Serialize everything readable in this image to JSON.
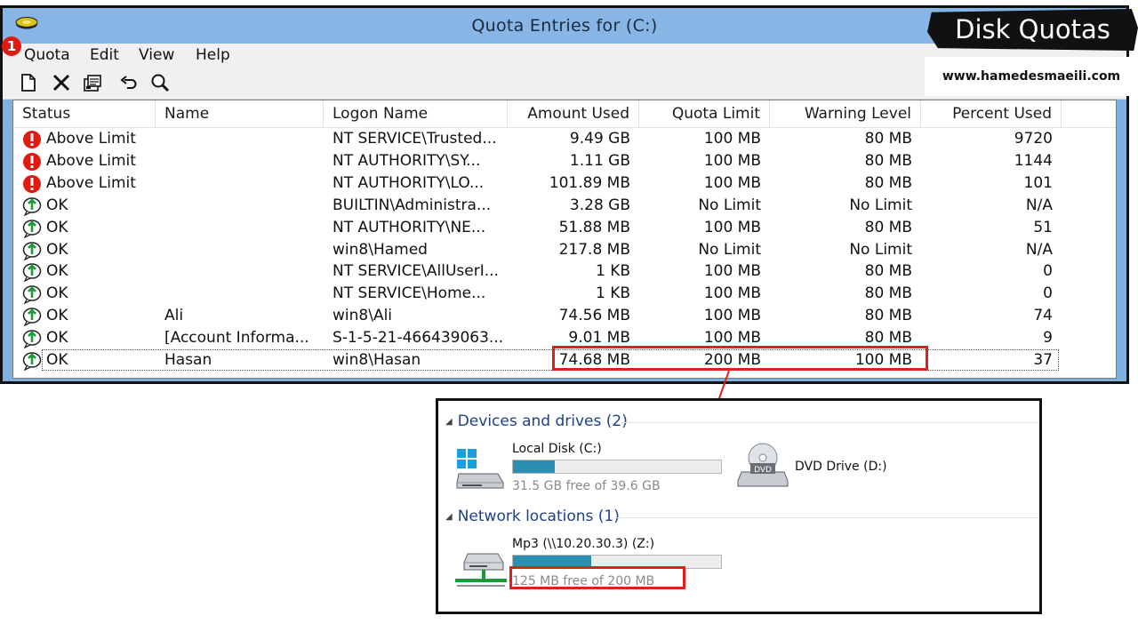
{
  "window": {
    "title": "Quota Entries for  (C:)",
    "badge": "1",
    "menu": [
      "Quota",
      "Edit",
      "View",
      "Help"
    ]
  },
  "toolbar": {
    "icons": [
      "new-entry-icon",
      "delete-icon",
      "properties-icon",
      "undo-icon",
      "find-icon"
    ]
  },
  "table": {
    "columns": [
      "Status",
      "Name",
      "Logon Name",
      "Amount Used",
      "Quota Limit",
      "Warning Level",
      "Percent Used"
    ],
    "rows": [
      {
        "status": "Above Limit",
        "name": "",
        "logon": "NT SERVICE\\Trusted...",
        "used": "9.49 GB",
        "limit": "100 MB",
        "warning": "80 MB",
        "percent": "9720"
      },
      {
        "status": "Above Limit",
        "name": "",
        "logon": "NT AUTHORITY\\SY...",
        "used": "1.11 GB",
        "limit": "100 MB",
        "warning": "80 MB",
        "percent": "1144"
      },
      {
        "status": "Above Limit",
        "name": "",
        "logon": "NT AUTHORITY\\LO...",
        "used": "101.89 MB",
        "limit": "100 MB",
        "warning": "80 MB",
        "percent": "101"
      },
      {
        "status": "OK",
        "name": "",
        "logon": "BUILTIN\\Administra...",
        "used": "3.28 GB",
        "limit": "No Limit",
        "warning": "No Limit",
        "percent": "N/A"
      },
      {
        "status": "OK",
        "name": "",
        "logon": "NT AUTHORITY\\NE...",
        "used": "51.88 MB",
        "limit": "100 MB",
        "warning": "80 MB",
        "percent": "51"
      },
      {
        "status": "OK",
        "name": "",
        "logon": "win8\\Hamed",
        "used": "217.8 MB",
        "limit": "No Limit",
        "warning": "No Limit",
        "percent": "N/A"
      },
      {
        "status": "OK",
        "name": "",
        "logon": "NT SERVICE\\AllUserI...",
        "used": "1 KB",
        "limit": "100 MB",
        "warning": "80 MB",
        "percent": "0"
      },
      {
        "status": "OK",
        "name": "",
        "logon": "NT SERVICE\\Home...",
        "used": "1 KB",
        "limit": "100 MB",
        "warning": "80 MB",
        "percent": "0"
      },
      {
        "status": "OK",
        "name": "Ali",
        "logon": "win8\\Ali",
        "used": "74.56 MB",
        "limit": "100 MB",
        "warning": "80 MB",
        "percent": "74"
      },
      {
        "status": "OK",
        "name": "[Account Informa...",
        "logon": "S-1-5-21-466439063...",
        "used": "9.01 MB",
        "limit": "100 MB",
        "warning": "80 MB",
        "percent": "9"
      },
      {
        "status": "OK",
        "name": "Hasan",
        "logon": "win8\\Hasan",
        "used": "74.68 MB",
        "limit": "200 MB",
        "warning": "100 MB",
        "percent": "37"
      }
    ]
  },
  "label": {
    "title": "Disk Quotas",
    "site": "www.hamedesmaeili.com"
  },
  "explorer": {
    "devices_heading": "Devices and drives (2)",
    "network_heading": "Network locations (1)",
    "local_disk": {
      "name": "Local Disk (C:)",
      "free": "31.5 GB free of 39.6 GB",
      "used_fraction": 0.2
    },
    "dvd": {
      "name": "DVD Drive (D:)",
      "badge": "DVD"
    },
    "mp3": {
      "name": "Mp3 (\\\\10.20.30.3) (Z:)",
      "free": "125 MB free of 200 MB",
      "used_fraction": 0.375
    }
  },
  "colors": {
    "titlebar": "#86b5e6",
    "error_red": "#e01a10",
    "ok_green": "#1d9a3a",
    "highlight_red": "#e0201b",
    "bar_fill": "#2a8fb0",
    "section_blue": "#1e3f8a"
  }
}
